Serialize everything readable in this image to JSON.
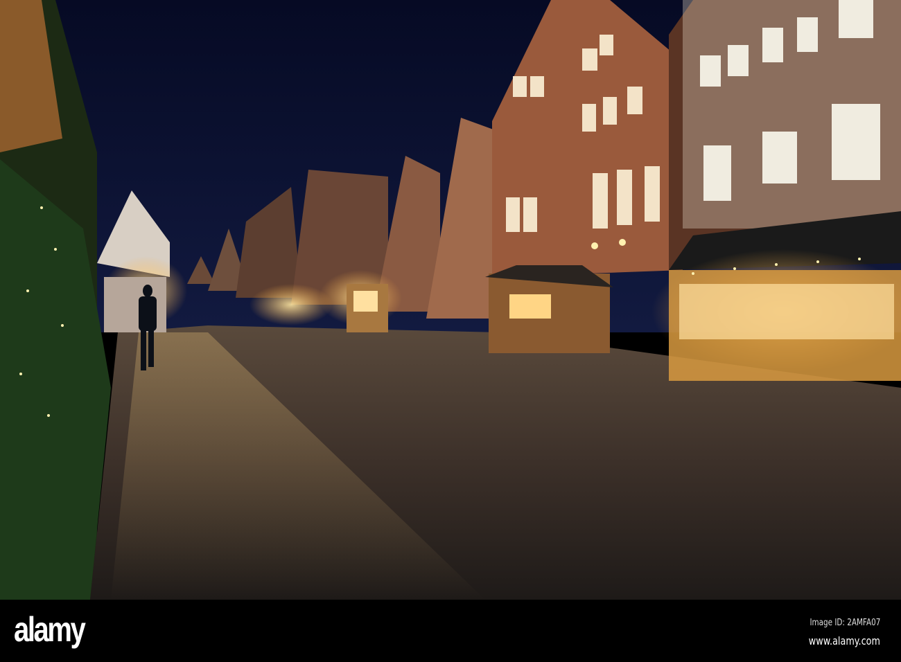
{
  "photo": {
    "subject": "Christmas market street at night",
    "watermark": "alamy"
  },
  "footer": {
    "logo": "alamy",
    "image_id": "Image ID: 2AMFA07",
    "url": "www.alamy.com"
  },
  "colors": {
    "sky": "#0a0f2e",
    "light": "#ffd37a",
    "pavement": "#4a3a2e"
  }
}
